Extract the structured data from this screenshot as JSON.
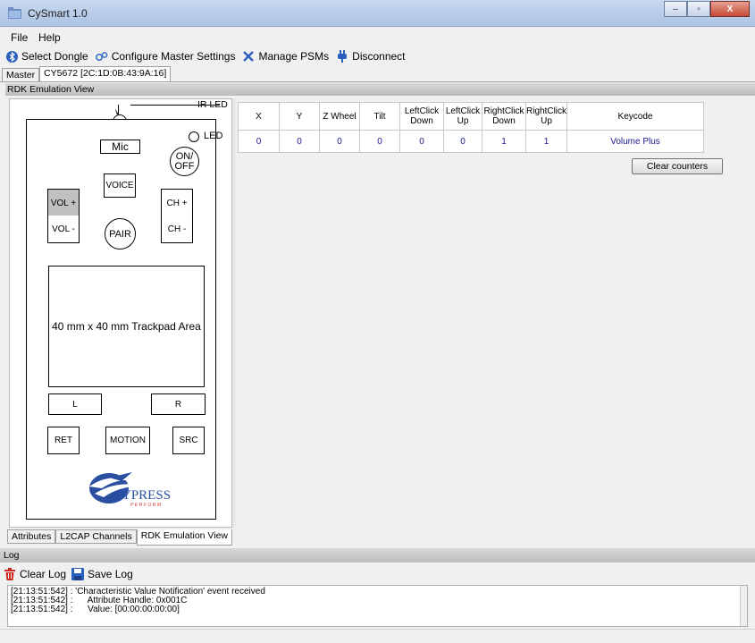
{
  "window": {
    "title": "CySmart 1.0",
    "minimize": "–",
    "maximize": "▫",
    "close": "X"
  },
  "menu": {
    "file": "File",
    "help": "Help"
  },
  "toolbar": {
    "select_dongle": "Select Dongle",
    "configure_master": "Configure Master Settings",
    "manage_psms": "Manage PSMs",
    "disconnect": "Disconnect"
  },
  "top_tabs": {
    "master": "Master",
    "device": "CY5672 [2C:1D:0B:43:9A:16]"
  },
  "view_header": "RDK Emulation View",
  "remote": {
    "ir_led": "IR LED",
    "led": "LED",
    "mic": "Mic",
    "on_off_1": "ON/",
    "on_off_2": "OFF",
    "voice": "VOICE",
    "vol_plus": "VOL +",
    "vol_minus": "VOL -",
    "pair": "PAIR",
    "ch_plus": "CH +",
    "ch_minus": "CH -",
    "trackpad": "40 mm x 40 mm Trackpad Area",
    "left": "L",
    "right": "R",
    "ret": "RET",
    "motion": "MOTION",
    "src": "SRC",
    "logo_text": "CYPRESS",
    "logo_sub": "PERFORM"
  },
  "table": {
    "headers": [
      "X",
      "Y",
      "Z Wheel",
      "Tilt",
      "LeftClick Down",
      "LeftClick Up",
      "RightClick Down",
      "RightClick Up",
      "Keycode"
    ],
    "row": [
      "0",
      "0",
      "0",
      "0",
      "0",
      "0",
      "1",
      "1",
      "Volume Plus"
    ]
  },
  "clear_counters": "Clear counters",
  "bottom_tabs": {
    "attributes": "Attributes",
    "l2cap": "L2CAP Channels",
    "rdk": "RDK Emulation View"
  },
  "log": {
    "header": "Log",
    "clear": "Clear Log",
    "save": "Save Log",
    "lines": [
      "[21:13:51:542] : 'Characteristic Value Notification' event received",
      "[21:13:51:542] :      Attribute Handle: 0x001C",
      "[21:13:51:542] :      Value: [00:00:00:00:00]"
    ]
  },
  "colors": {
    "accent_blue": "#1a1a8c",
    "vol_plus_active": "#c0c0c0",
    "logo_blue": "#2a4fa0",
    "logo_red": "#d0342c"
  }
}
